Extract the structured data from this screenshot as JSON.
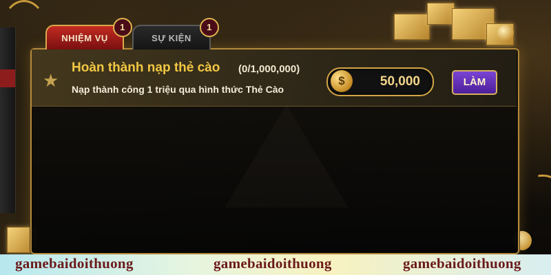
{
  "tabs": [
    {
      "label": "NHIỆM VỤ",
      "badge": "1",
      "active": true
    },
    {
      "label": "SỰ KIỆN",
      "badge": "1",
      "active": false
    }
  ],
  "task": {
    "title": "Hoàn thành nạp thẻ cào",
    "progress": "(0/1,000,000)",
    "description": "Nạp thành công 1 triệu qua hình thức Thẻ Cào",
    "reward_icon": "coin-icon",
    "reward_icon_glyph": "$",
    "reward_value": "50,000",
    "action_label": "LÀM",
    "star_icon": "star-icon"
  },
  "watermarks": [
    "gamebaidoithuong",
    "gamebaidoithuong",
    "gamebaidoithuong"
  ],
  "colors": {
    "accent_gold": "#f2c744",
    "tab_active_red": "#c22b22",
    "action_purple": "#7a44d4",
    "panel_border": "#b58a3a"
  }
}
